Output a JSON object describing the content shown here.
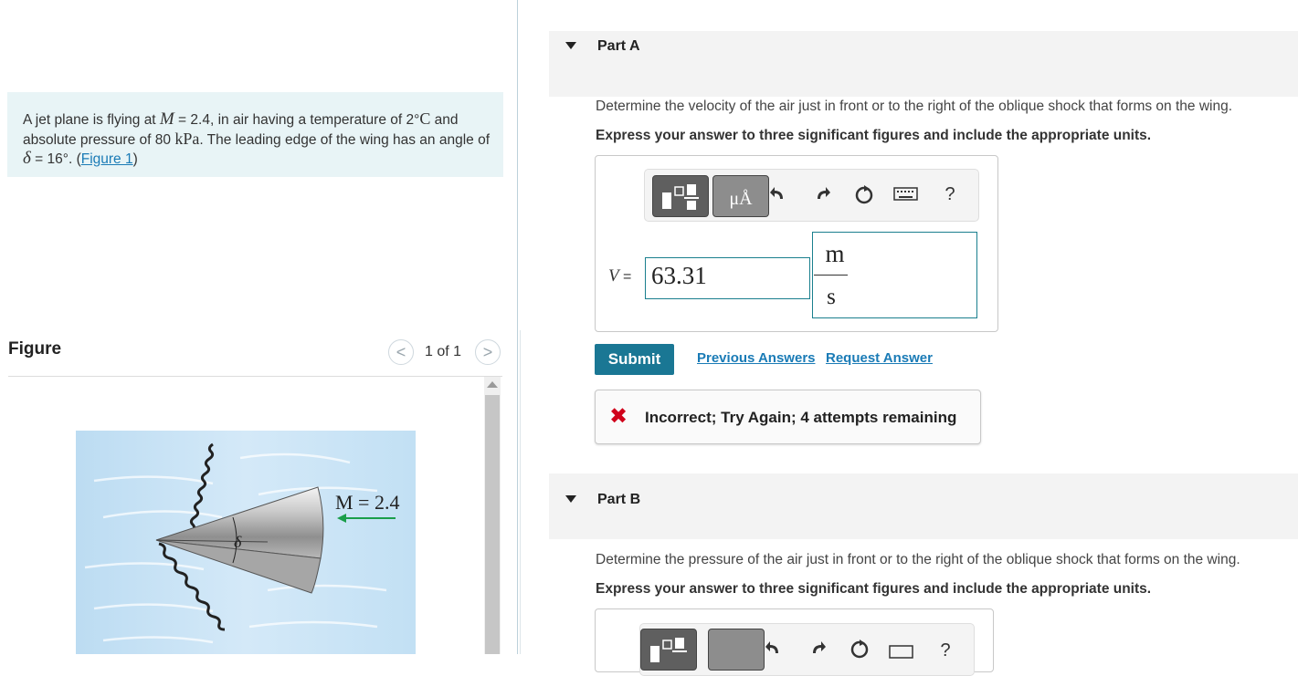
{
  "problem": {
    "text_1": "A jet plane is flying at ",
    "var_M": "M",
    "text_2": " = 2.4, in air having a temperature of 2",
    "deg": "°",
    "unit_C": "C",
    "text_3": " and absolute pressure of 80 ",
    "unit_kPa": "kPa",
    "text_4": ". The leading edge of the wing has an angle of ",
    "var_delta": "δ",
    "text_5": " = 16",
    "text_6": ". (",
    "figure_link": "Figure 1",
    "text_7": ")"
  },
  "figure": {
    "title": "Figure",
    "count": "1 of 1",
    "prev_glyph": "<",
    "next_glyph": ">",
    "image_label_mach": "M = 2.4",
    "image_label_delta": "δ"
  },
  "part_a": {
    "title": "Part A",
    "question": "Determine the velocity of the air just in front or to the right of the oblique shock that forms on the wing.",
    "instruction": "Express your answer to three significant figures and include the appropriate units.",
    "toolbar": {
      "units_button_label": "μÅ",
      "help_label": "?"
    },
    "answer_var": "V",
    "answer_eq": " =",
    "answer_value": "63.31",
    "unit_numerator": "m",
    "unit_denominator": "s",
    "submit_label": "Submit",
    "previous_answers_label": "Previous Answers",
    "request_answer_label": "Request Answer",
    "feedback_icon": "✖",
    "feedback_text": "Incorrect; Try Again; 4 attempts remaining"
  },
  "part_b": {
    "title": "Part B",
    "question": "Determine the pressure of the air just in front or to the right of the oblique shock that forms on the wing.",
    "instruction": "Express your answer to three significant figures and include the appropriate units.",
    "toolbar": {
      "help_label": "?"
    }
  },
  "colors": {
    "accent": "#1a7794",
    "link": "#1a7bb6",
    "error": "#d0021b",
    "problem_bg": "#e8f4f6",
    "input_border": "#1a7f8e"
  }
}
